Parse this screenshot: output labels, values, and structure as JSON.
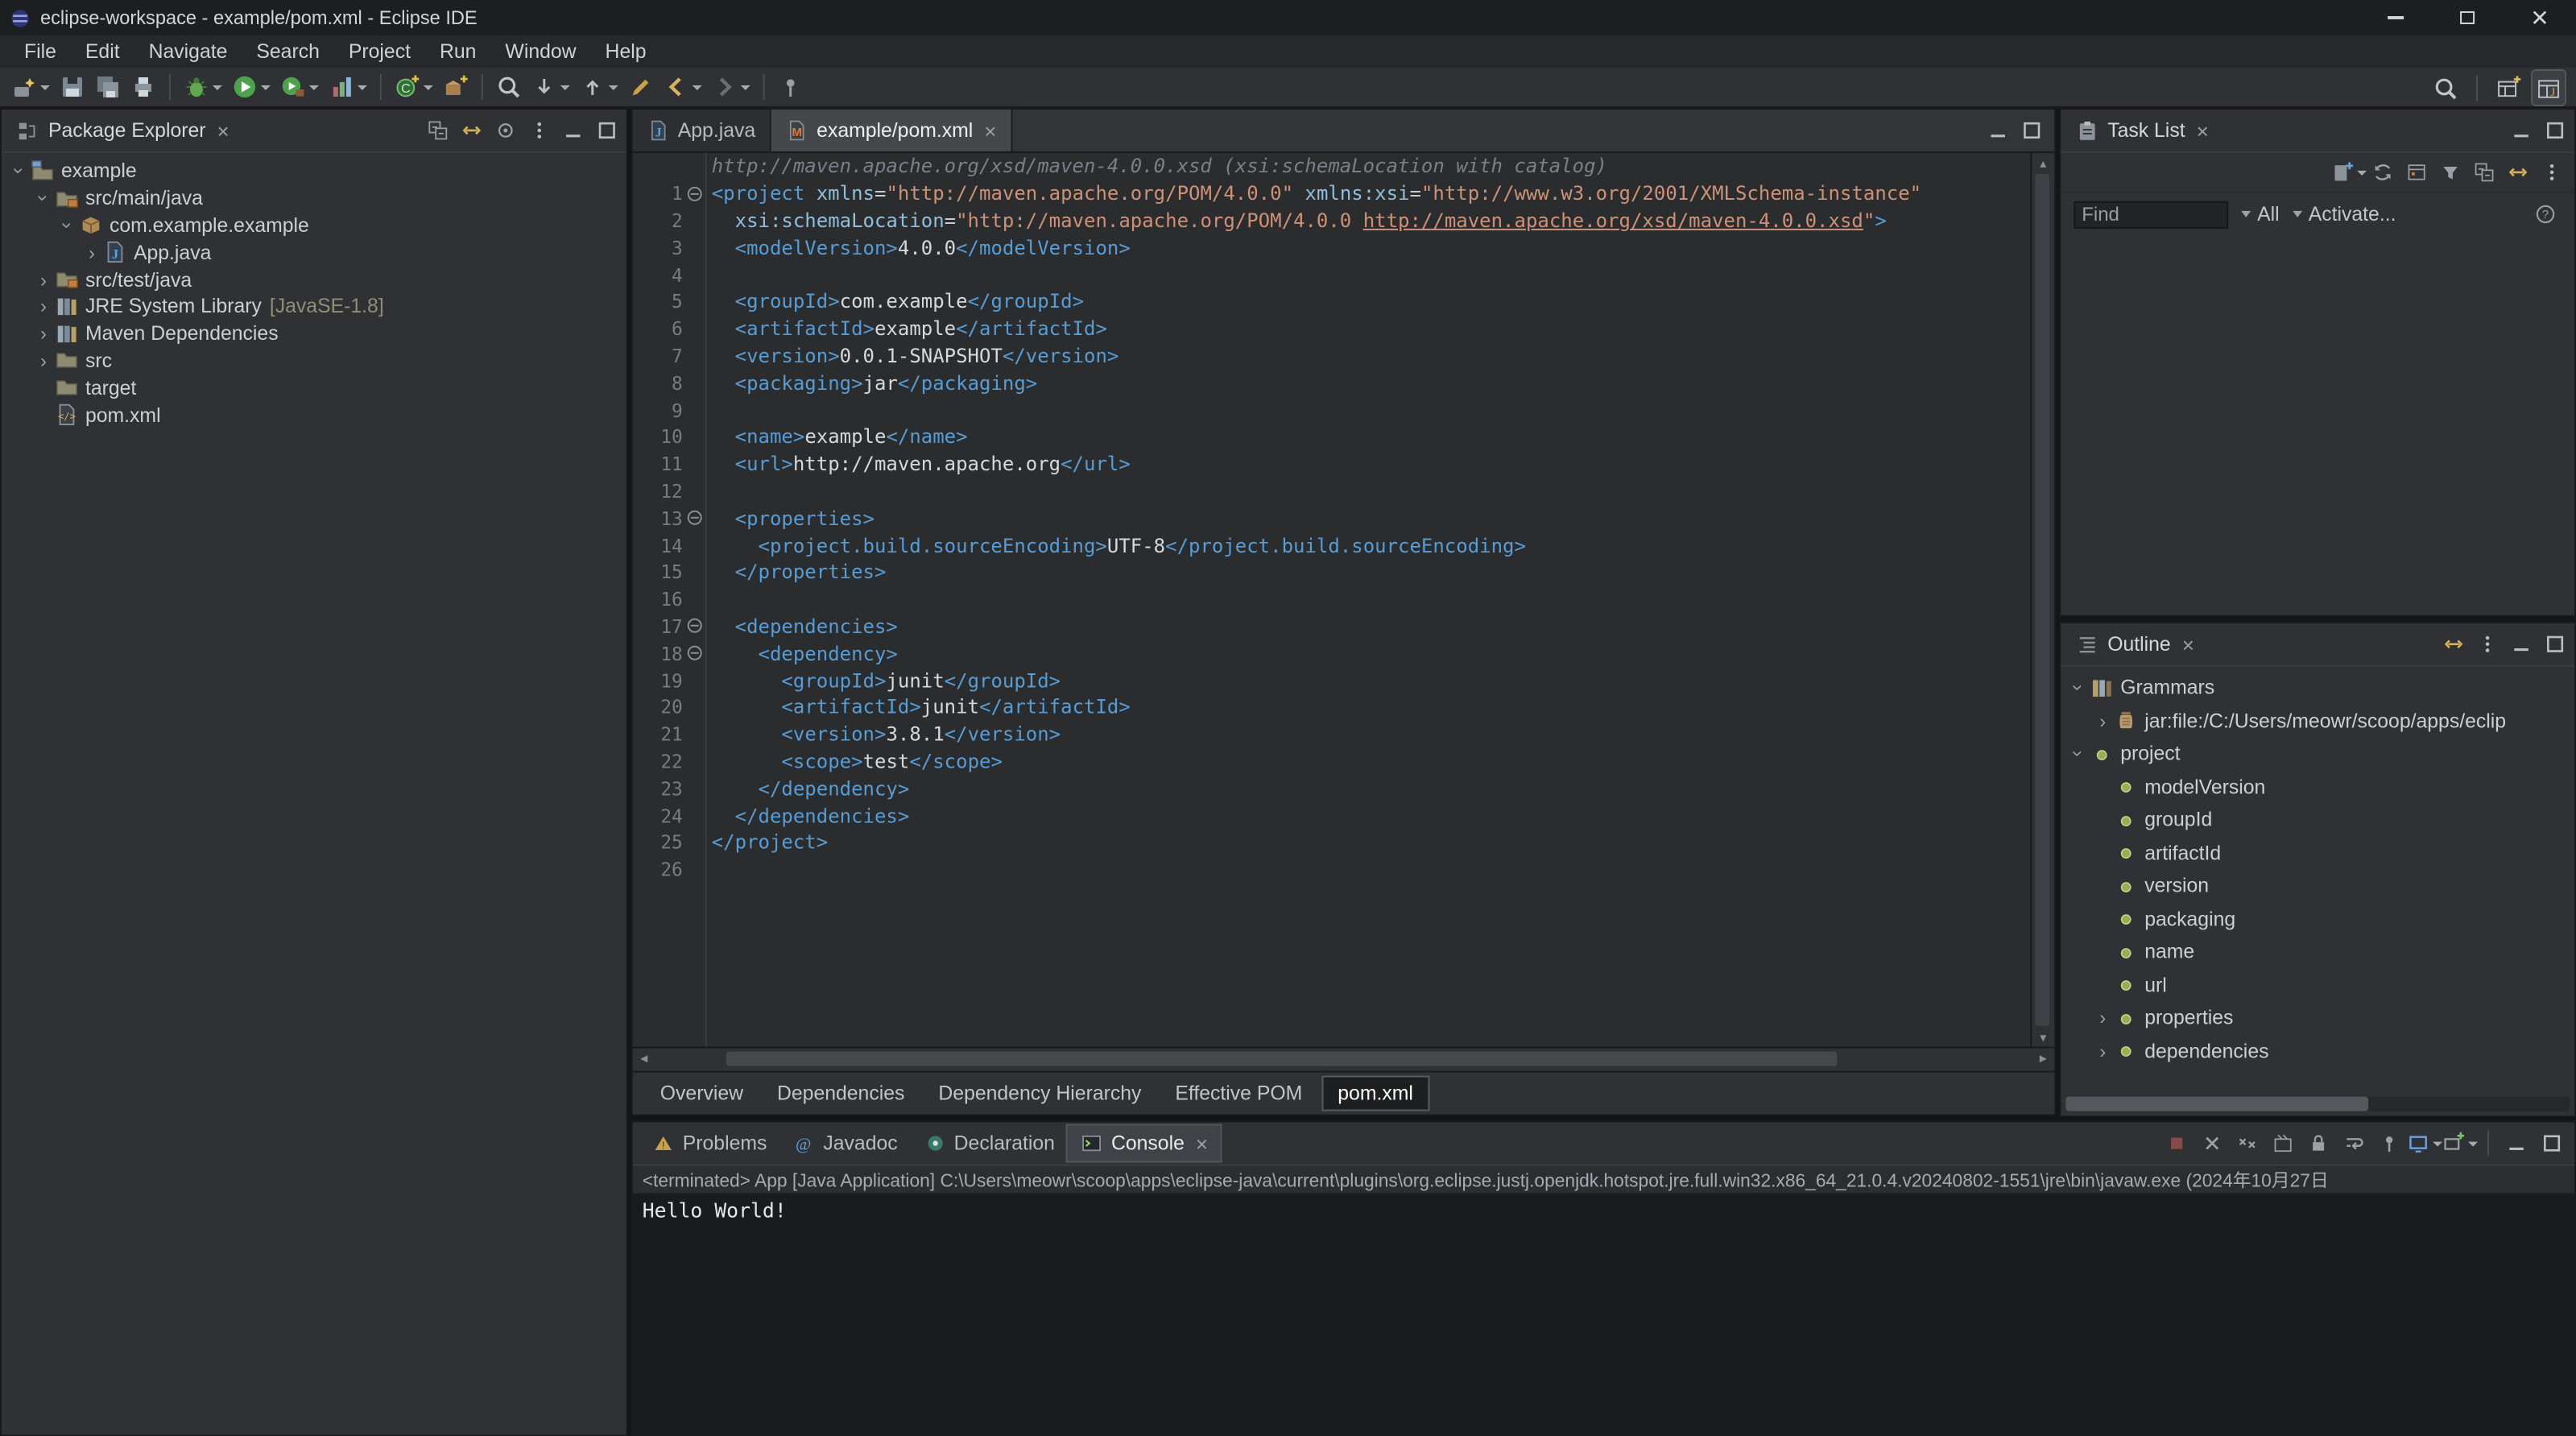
{
  "window": {
    "title": "eclipse-workspace - example/pom.xml - Eclipse IDE"
  },
  "colors": {
    "code_tag": "#569cd6",
    "code_attr": "#8fbfdc",
    "code_string": "#ce9178",
    "code_text": "#d6d9dc",
    "code_annotation": "#78808a",
    "nav_gold": "#d7b35e",
    "run_green": "#4da24d",
    "element_green": "#99ad54"
  },
  "menu": {
    "items": [
      "File",
      "Edit",
      "Navigate",
      "Search",
      "Project",
      "Run",
      "Window",
      "Help"
    ]
  },
  "main_toolbar": {
    "buttons": [
      {
        "name": "new-wizard",
        "icon": "new-wizard",
        "dropdown": true
      },
      {
        "name": "save",
        "icon": "save"
      },
      {
        "name": "save-all",
        "icon": "save-all"
      },
      {
        "name": "print",
        "icon": "print"
      },
      {
        "sep": true
      },
      {
        "name": "debug",
        "icon": "bug",
        "dropdown": true
      },
      {
        "name": "run",
        "icon": "run",
        "dropdown": true
      },
      {
        "name": "run-external-tools",
        "icon": "external",
        "dropdown": true
      },
      {
        "name": "coverage",
        "icon": "coverage",
        "dropdown": true
      },
      {
        "sep": true
      },
      {
        "name": "new-java-class",
        "icon": "class-new",
        "dropdown": true
      },
      {
        "name": "new-java-package",
        "icon": "package-new"
      },
      {
        "sep": true
      },
      {
        "name": "open-search-dialog",
        "icon": "magnifier"
      },
      {
        "name": "next-annotation",
        "icon": "arrow-down",
        "dropdown": true
      },
      {
        "name": "previous-annotation",
        "icon": "arrow-up",
        "dropdown": true
      },
      {
        "name": "last-edit-location",
        "icon": "pencil"
      },
      {
        "name": "back",
        "icon": "back",
        "dropdown": true
      },
      {
        "name": "forward",
        "icon": "forward",
        "dropdown": true
      },
      {
        "sep": true
      },
      {
        "name": "pin-editor",
        "icon": "pin"
      }
    ],
    "right": [
      {
        "name": "quick-search",
        "icon": "magnifier"
      },
      {
        "sep": true
      },
      {
        "name": "open-perspective",
        "icon": "persp-open"
      },
      {
        "name": "java-perspective",
        "icon": "persp-java",
        "active": true
      }
    ]
  },
  "package_explorer": {
    "title": "Package Explorer",
    "header_icons": [
      {
        "name": "collapse-all",
        "icon": "collapse-all"
      },
      {
        "name": "link-with-editor",
        "icon": "link-editor"
      },
      {
        "name": "focus",
        "icon": "focus"
      },
      {
        "name": "view-menu",
        "icon": "view-menu"
      },
      {
        "name": "minimize-view",
        "icon": "min"
      },
      {
        "name": "maximize-view",
        "icon": "max"
      }
    ],
    "tree": [
      {
        "label": "example",
        "level": 0,
        "icon": "project",
        "expander": "expanded"
      },
      {
        "label": "src/main/java",
        "level": 1,
        "icon": "source-folder",
        "expander": "expanded"
      },
      {
        "label": "com.example.example",
        "level": 2,
        "icon": "package",
        "expander": "expanded"
      },
      {
        "label": "App.java",
        "level": 3,
        "icon": "java-file",
        "expander": "collapsed"
      },
      {
        "label": "src/test/java",
        "level": 1,
        "icon": "source-folder",
        "expander": "collapsed"
      },
      {
        "label": "JRE System Library",
        "qualifier": "[JavaSE-1.8]",
        "level": 1,
        "icon": "library",
        "expander": "collapsed"
      },
      {
        "label": "Maven Dependencies",
        "level": 1,
        "icon": "library",
        "expander": "collapsed"
      },
      {
        "label": "src",
        "level": 1,
        "icon": "folder",
        "expander": "collapsed"
      },
      {
        "label": "target",
        "level": 1,
        "icon": "folder",
        "expander": "none"
      },
      {
        "label": "pom.xml",
        "level": 1,
        "icon": "xml-file",
        "expander": "none"
      }
    ]
  },
  "editor": {
    "tabs": [
      {
        "label": "App.java",
        "icon": "java-file",
        "active": false
      },
      {
        "label": "example/pom.xml",
        "icon": "maven-file",
        "active": true,
        "closable": true
      }
    ],
    "annotation": "http://maven.apache.org/xsd/maven-4.0.0.xsd (xsi:schemaLocation with catalog)",
    "lines": [
      {
        "n": 1,
        "fold": true,
        "tokens": [
          [
            "tag",
            "<project"
          ],
          [
            "attr",
            " xmlns"
          ],
          [
            "eq",
            "="
          ],
          [
            "str",
            "\"http://maven.apache.org/POM/4.0.0\""
          ],
          [
            "attr",
            " xmlns:xsi"
          ],
          [
            "eq",
            "="
          ],
          [
            "str",
            "\"http://www.w3.org/2001/XMLSchema-instance\""
          ]
        ]
      },
      {
        "n": 2,
        "tokens": [
          [
            "plain",
            "  "
          ],
          [
            "attr",
            "xsi:schemaLocation"
          ],
          [
            "eq",
            "="
          ],
          [
            "str",
            "\"http://maven.apache.org/POM/4.0.0 "
          ],
          [
            "strlink",
            "http://maven.apache.org/xsd/maven-4.0.0.xsd"
          ],
          [
            "str",
            "\""
          ],
          [
            "tag",
            ">"
          ]
        ]
      },
      {
        "n": 3,
        "tokens": [
          [
            "plain",
            "  "
          ],
          [
            "tag",
            "<modelVersion>"
          ],
          [
            "text",
            "4.0.0"
          ],
          [
            "tag",
            "</modelVersion>"
          ]
        ]
      },
      {
        "n": 4,
        "tokens": []
      },
      {
        "n": 5,
        "tokens": [
          [
            "plain",
            "  "
          ],
          [
            "tag",
            "<groupId>"
          ],
          [
            "text",
            "com.example"
          ],
          [
            "tag",
            "</groupId>"
          ]
        ]
      },
      {
        "n": 6,
        "tokens": [
          [
            "plain",
            "  "
          ],
          [
            "tag",
            "<artifactId>"
          ],
          [
            "text",
            "example"
          ],
          [
            "tag",
            "</artifactId>"
          ]
        ]
      },
      {
        "n": 7,
        "tokens": [
          [
            "plain",
            "  "
          ],
          [
            "tag",
            "<version>"
          ],
          [
            "text",
            "0.0.1-SNAPSHOT"
          ],
          [
            "tag",
            "</version>"
          ]
        ]
      },
      {
        "n": 8,
        "tokens": [
          [
            "plain",
            "  "
          ],
          [
            "tag",
            "<packaging>"
          ],
          [
            "text",
            "jar"
          ],
          [
            "tag",
            "</packaging>"
          ]
        ]
      },
      {
        "n": 9,
        "tokens": []
      },
      {
        "n": 10,
        "tokens": [
          [
            "plain",
            "  "
          ],
          [
            "tag",
            "<name>"
          ],
          [
            "text",
            "example"
          ],
          [
            "tag",
            "</name>"
          ]
        ]
      },
      {
        "n": 11,
        "tokens": [
          [
            "plain",
            "  "
          ],
          [
            "tag",
            "<url>"
          ],
          [
            "text",
            "http://maven.apache.org"
          ],
          [
            "tag",
            "</url>"
          ]
        ]
      },
      {
        "n": 12,
        "tokens": []
      },
      {
        "n": 13,
        "fold": true,
        "tokens": [
          [
            "plain",
            "  "
          ],
          [
            "tag",
            "<properties>"
          ]
        ]
      },
      {
        "n": 14,
        "tokens": [
          [
            "plain",
            "    "
          ],
          [
            "tag",
            "<project.build.sourceEncoding>"
          ],
          [
            "text",
            "UTF-8"
          ],
          [
            "tag",
            "</project.build.sourceEncoding>"
          ]
        ]
      },
      {
        "n": 15,
        "tokens": [
          [
            "plain",
            "  "
          ],
          [
            "tag",
            "</properties>"
          ]
        ]
      },
      {
        "n": 16,
        "tokens": []
      },
      {
        "n": 17,
        "fold": true,
        "tokens": [
          [
            "plain",
            "  "
          ],
          [
            "tag",
            "<dependencies>"
          ]
        ]
      },
      {
        "n": 18,
        "fold": true,
        "tokens": [
          [
            "plain",
            "    "
          ],
          [
            "tag",
            "<dependency>"
          ]
        ]
      },
      {
        "n": 19,
        "tokens": [
          [
            "plain",
            "      "
          ],
          [
            "tag",
            "<groupId>"
          ],
          [
            "text",
            "junit"
          ],
          [
            "tag",
            "</groupId>"
          ]
        ]
      },
      {
        "n": 20,
        "tokens": [
          [
            "plain",
            "      "
          ],
          [
            "tag",
            "<artifactId>"
          ],
          [
            "text",
            "junit"
          ],
          [
            "tag",
            "</artifactId>"
          ]
        ]
      },
      {
        "n": 21,
        "tokens": [
          [
            "plain",
            "      "
          ],
          [
            "tag",
            "<version>"
          ],
          [
            "text",
            "3.8.1"
          ],
          [
            "tag",
            "</version>"
          ]
        ]
      },
      {
        "n": 22,
        "tokens": [
          [
            "plain",
            "      "
          ],
          [
            "tag",
            "<scope>"
          ],
          [
            "text",
            "test"
          ],
          [
            "tag",
            "</scope>"
          ]
        ]
      },
      {
        "n": 23,
        "tokens": [
          [
            "plain",
            "    "
          ],
          [
            "tag",
            "</dependency>"
          ]
        ]
      },
      {
        "n": 24,
        "tokens": [
          [
            "plain",
            "  "
          ],
          [
            "tag",
            "</dependencies>"
          ]
        ]
      },
      {
        "n": 25,
        "tokens": [
          [
            "tag",
            "</project>"
          ]
        ]
      },
      {
        "n": 26,
        "tokens": []
      }
    ],
    "page_tabs": [
      {
        "label": "Overview"
      },
      {
        "label": "Dependencies"
      },
      {
        "label": "Dependency Hierarchy"
      },
      {
        "label": "Effective POM"
      },
      {
        "label": "pom.xml",
        "active": true
      }
    ]
  },
  "task_list": {
    "title": "Task List",
    "find_value": "Find",
    "scope_all": "All",
    "activate_label": "Activate...",
    "header_icons": [
      {
        "name": "minimize-view",
        "icon": "min"
      },
      {
        "name": "maximize-view",
        "icon": "max"
      }
    ],
    "toolbar": [
      {
        "name": "new-task",
        "icon": "new-task",
        "dropdown": true
      },
      {
        "name": "synchronize",
        "icon": "sync"
      },
      {
        "name": "show-scheduled",
        "icon": "calendar"
      },
      {
        "name": "filter-tasks",
        "icon": "filter"
      },
      {
        "name": "collapse-all",
        "icon": "collapse-all"
      },
      {
        "name": "link-with-editor",
        "icon": "link-editor"
      },
      {
        "name": "view-menu",
        "icon": "view-menu"
      }
    ]
  },
  "outline": {
    "title": "Outline",
    "header_icons": [
      {
        "name": "link-with-editor",
        "icon": "link-editor"
      },
      {
        "name": "view-menu",
        "icon": "view-menu"
      },
      {
        "name": "minimize-view",
        "icon": "min"
      },
      {
        "name": "maximize-view",
        "icon": "max"
      }
    ],
    "tree": [
      {
        "label": "Grammars",
        "level": 0,
        "icon": "grammars",
        "expander": "expanded"
      },
      {
        "label": "jar:file:/C:/Users/meowr/scoop/apps/eclip",
        "level": 1,
        "icon": "jar",
        "expander": "collapsed"
      },
      {
        "label": "project",
        "level": 0,
        "icon": "element",
        "expander": "expanded"
      },
      {
        "label": "modelVersion",
        "level": 1,
        "icon": "element",
        "expander": "none"
      },
      {
        "label": "groupId",
        "level": 1,
        "icon": "element",
        "expander": "none"
      },
      {
        "label": "artifactId",
        "level": 1,
        "icon": "element",
        "expander": "none"
      },
      {
        "label": "version",
        "level": 1,
        "icon": "element",
        "expander": "none"
      },
      {
        "label": "packaging",
        "level": 1,
        "icon": "element",
        "expander": "none"
      },
      {
        "label": "name",
        "level": 1,
        "icon": "element",
        "expander": "none"
      },
      {
        "label": "url",
        "level": 1,
        "icon": "element",
        "expander": "none"
      },
      {
        "label": "properties",
        "level": 1,
        "icon": "element",
        "expander": "collapsed"
      },
      {
        "label": "dependencies",
        "level": 1,
        "icon": "element",
        "expander": "collapsed"
      }
    ]
  },
  "console": {
    "tabs": [
      {
        "label": "Problems",
        "icon": "problems"
      },
      {
        "label": "Javadoc",
        "icon": "javadoc"
      },
      {
        "label": "Declaration",
        "icon": "declaration"
      },
      {
        "label": "Console",
        "icon": "console",
        "active": true,
        "closable": true
      }
    ],
    "toolbar": [
      {
        "name": "terminate",
        "icon": "terminate"
      },
      {
        "name": "remove-launch",
        "icon": "remove-x"
      },
      {
        "name": "remove-all-terminated",
        "icon": "remove-xx"
      },
      {
        "name": "clear-console",
        "icon": "clear"
      },
      {
        "name": "scroll-lock",
        "icon": "scroll-lock"
      },
      {
        "name": "word-wrap",
        "icon": "word-wrap"
      },
      {
        "name": "pin-console",
        "icon": "pin"
      },
      {
        "name": "display-selected-console",
        "icon": "monitor-blue",
        "dropdown": true
      },
      {
        "name": "open-console",
        "icon": "monitor-new",
        "dropdown": true
      },
      {
        "sep": true
      },
      {
        "name": "minimize-view",
        "icon": "min"
      },
      {
        "name": "maximize-view",
        "icon": "max"
      }
    ],
    "status": "<terminated> App [Java Application] C:\\Users\\meowr\\scoop\\apps\\eclipse-java\\current\\plugins\\org.eclipse.justj.openjdk.hotspot.jre.full.win32.x86_64_21.0.4.v20240802-1551\\jre\\bin\\javaw.exe (2024年10月27日",
    "output": "Hello World!"
  }
}
